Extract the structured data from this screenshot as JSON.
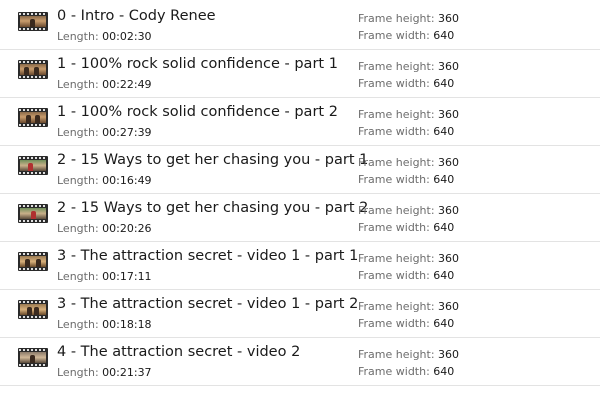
{
  "labels": {
    "length": "Length:",
    "frame_height": "Frame height:",
    "frame_width": "Frame width:"
  },
  "files": [
    {
      "title": "0 - Intro - Cody Renee",
      "length": "00:02:30",
      "frame_height": "360",
      "frame_width": "640",
      "thumb_icon": "video-thumbnail-icon"
    },
    {
      "title": "1 - 100% rock solid confidence - part 1",
      "length": "00:22:49",
      "frame_height": "360",
      "frame_width": "640",
      "thumb_icon": "video-thumbnail-icon"
    },
    {
      "title": "1 - 100% rock solid confidence - part 2",
      "length": "00:27:39",
      "frame_height": "360",
      "frame_width": "640",
      "thumb_icon": "video-thumbnail-icon"
    },
    {
      "title": "2 - 15 Ways to get her chasing you - part 1",
      "length": "00:16:49",
      "frame_height": "360",
      "frame_width": "640",
      "thumb_icon": "video-thumbnail-icon"
    },
    {
      "title": "2 - 15 Ways to get her chasing you - part 2",
      "length": "00:20:26",
      "frame_height": "360",
      "frame_width": "640",
      "thumb_icon": "video-thumbnail-icon"
    },
    {
      "title": "3 - The attraction secret - video 1 - part 1",
      "length": "00:17:11",
      "frame_height": "360",
      "frame_width": "640",
      "thumb_icon": "video-thumbnail-icon"
    },
    {
      "title": "3 - The attraction secret - video 1 - part 2",
      "length": "00:18:18",
      "frame_height": "360",
      "frame_width": "640",
      "thumb_icon": "video-thumbnail-icon"
    },
    {
      "title": "4 - The attraction secret - video 2",
      "length": "00:21:37",
      "frame_height": "360",
      "frame_width": "640",
      "thumb_icon": "video-thumbnail-icon"
    }
  ]
}
